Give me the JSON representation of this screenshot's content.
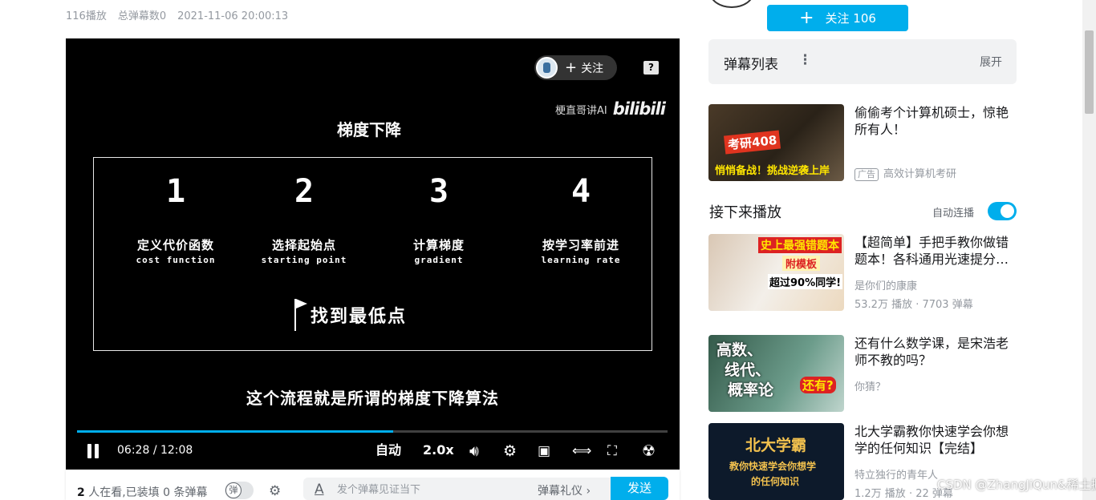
{
  "meta": {
    "plays": "116播放",
    "danmaku_total": "总弹幕数0",
    "date": "2021-11-06 20:00:13"
  },
  "player": {
    "follow_label": "关注",
    "help_glyph": "?",
    "watermark_text": "梗直哥讲AI",
    "watermark_logo": "bilibili",
    "slide": {
      "title": "梯度下降",
      "steps": [
        {
          "num": "1",
          "cn": "定义代价函数",
          "en": "cost function"
        },
        {
          "num": "2",
          "cn": "选择起始点",
          "en": "starting point"
        },
        {
          "num": "3",
          "cn": "计算梯度",
          "en": "gradient"
        },
        {
          "num": "4",
          "cn": "按学习率前进",
          "en": "learning rate"
        }
      ],
      "goal": "找到最低点"
    },
    "subtitle": "这个流程就是所谓的梯度下降算法",
    "progress": 0.536,
    "current_time": "06:28",
    "separator": "/",
    "duration": "12:08",
    "quality": "自动",
    "speed": "2.0x"
  },
  "danmaku_bar": {
    "viewers_count": "2",
    "viewers_text": "人在看,已装填",
    "loaded_count": "0",
    "loaded_text": "条弹幕",
    "toggle_glyph": "弹",
    "input_placeholder": "发个弹幕见证当下",
    "gift_label": "弹幕礼仪 ›",
    "send_label": "发送"
  },
  "sidebar": {
    "follow_button": "关注 106",
    "danmaku_list_title": "弹幕列表",
    "danmaku_list_expand": "展开",
    "ad": {
      "title": "偷偷考个计算机硕士，惊艳所有人！",
      "tag": "广告",
      "source": "高效计算机考研",
      "thumb_text_1": "考研408",
      "thumb_text_2": "悄悄备战！挑战逆袭上岸"
    },
    "next_title": "接下来播放",
    "autoplay_label": "自动连播",
    "autoplay_on": true,
    "recommendations": [
      {
        "title": "【超简单】手把手教你做错题本！各科通用光速提分…",
        "author": "是你们的康康",
        "stats": "53.2万 播放 · 7703 弹幕",
        "thumb_text_1": "史上最强错题本",
        "thumb_text_2": "附模板",
        "thumb_text_3": "超过90%同学!"
      },
      {
        "title": "还有什么数学课，是宋浩老师不教的吗？",
        "author": "你猜？",
        "stats": "",
        "thumb_text_1": "高数、",
        "thumb_text_2": "线代、",
        "thumb_text_3": "概率论",
        "thumb_text_4": "还有?"
      },
      {
        "title": "北大学霸教你快速学会你想学的任何知识【完结】",
        "author": "特立独行的青年人",
        "stats": "1.2万 播放 · 22 弹幕",
        "thumb_text_1": "北大学霸",
        "thumb_text_2": "教你快速学会你想学",
        "thumb_text_3": "的任何知识"
      }
    ]
  },
  "overlay_watermark": "CSDN @ZhangJiQun&稀土掘金技术社区",
  "colors": {
    "accent": "#00aeec",
    "player_bg": "#000000",
    "muted_text": "#9499a0"
  }
}
